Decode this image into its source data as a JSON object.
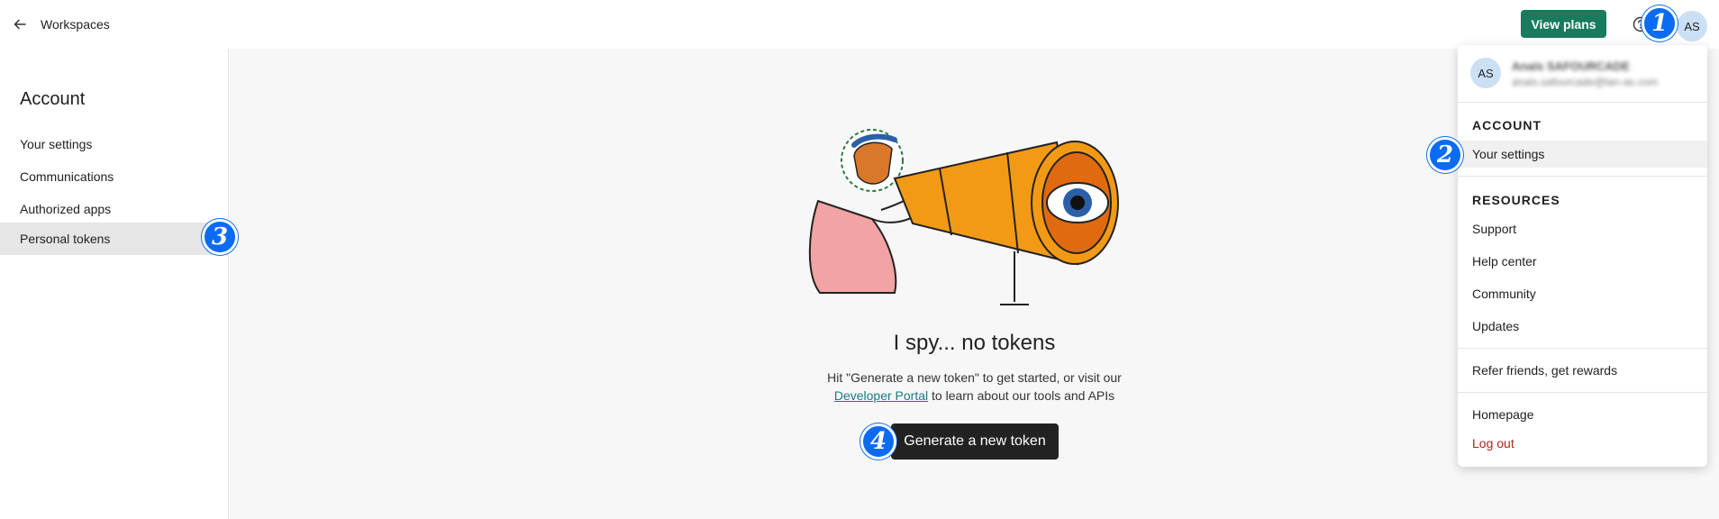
{
  "topbar": {
    "back_icon": "arrow-left-icon",
    "workspace_label": "Workspaces",
    "view_plans_label": "View plans",
    "help_icon": "help-circle-icon",
    "avatar_initials": "AS"
  },
  "sidebar": {
    "title": "Account",
    "items": [
      {
        "label": "Your settings"
      },
      {
        "label": "Communications"
      },
      {
        "label": "Authorized apps"
      },
      {
        "label": "Personal tokens"
      }
    ]
  },
  "main": {
    "title": "I spy... no tokens",
    "desc_before": "Hit \"Generate a new token\" to get started, or visit our",
    "desc_link": "Developer Portal",
    "desc_after": " to learn about our tools and APIs",
    "button_label": "Generate a new token"
  },
  "dropdown": {
    "avatar_initials": "AS",
    "user_name": "Anaïs SAFOURCADE",
    "user_email": "anais.safourcade@lan-as.com",
    "account_heading": "ACCOUNT",
    "account_items": [
      "Your settings"
    ],
    "resources_heading": "RESOURCES",
    "resources_items": [
      "Support",
      "Help center",
      "Community",
      "Updates"
    ],
    "referral": "Refer friends, get rewards",
    "homepage": "Homepage",
    "logout": "Log out"
  },
  "markers": [
    "1",
    "2",
    "3",
    "4"
  ],
  "colors": {
    "primary_green": "#1a7a5e",
    "marker_blue": "#0b6bf2",
    "logout_red": "#b42318",
    "link_teal": "#1a7a8a"
  }
}
